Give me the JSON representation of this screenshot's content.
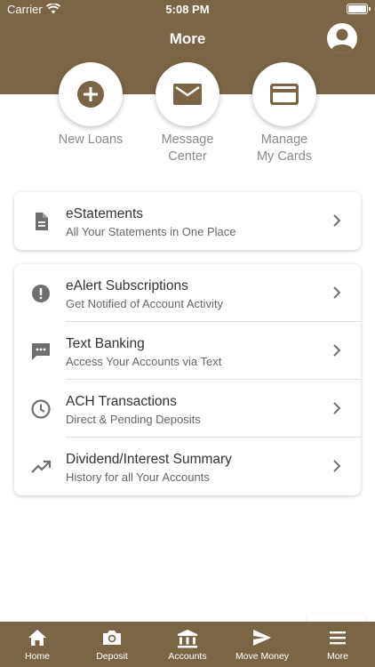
{
  "status": {
    "carrier": "Carrier",
    "time": "5:08 PM"
  },
  "header": {
    "title": "More"
  },
  "quick_actions": [
    {
      "label": "New Loans",
      "icon": "add-circle-icon"
    },
    {
      "label": "Message\nCenter",
      "icon": "mail-icon"
    },
    {
      "label": "Manage\nMy Cards",
      "icon": "credit-card-icon"
    }
  ],
  "statements": {
    "title": "eStatements",
    "subtitle": "All Your Statements in One Place",
    "icon": "document-icon"
  },
  "menu": [
    {
      "title": "eAlert Subscriptions",
      "subtitle": "Get Notified of Account Activity",
      "icon": "alert-icon"
    },
    {
      "title": "Text Banking",
      "subtitle": "Access Your Accounts via Text",
      "icon": "chat-icon"
    },
    {
      "title": "ACH Transactions",
      "subtitle": "Direct & Pending Deposits",
      "icon": "clock-icon"
    },
    {
      "title": "Dividend/Interest Summary",
      "subtitle": "History for all Your Accounts",
      "icon": "trending-up-icon"
    }
  ],
  "tabs": [
    {
      "label": "Home",
      "icon": "home-icon"
    },
    {
      "label": "Deposit",
      "icon": "camera-icon"
    },
    {
      "label": "Accounts",
      "icon": "bank-icon"
    },
    {
      "label": "Move Money",
      "icon": "send-icon"
    },
    {
      "label": "More",
      "icon": "menu-icon"
    }
  ],
  "colors": {
    "brand": "#7a6547",
    "icon_gray": "#6f6f6f"
  }
}
